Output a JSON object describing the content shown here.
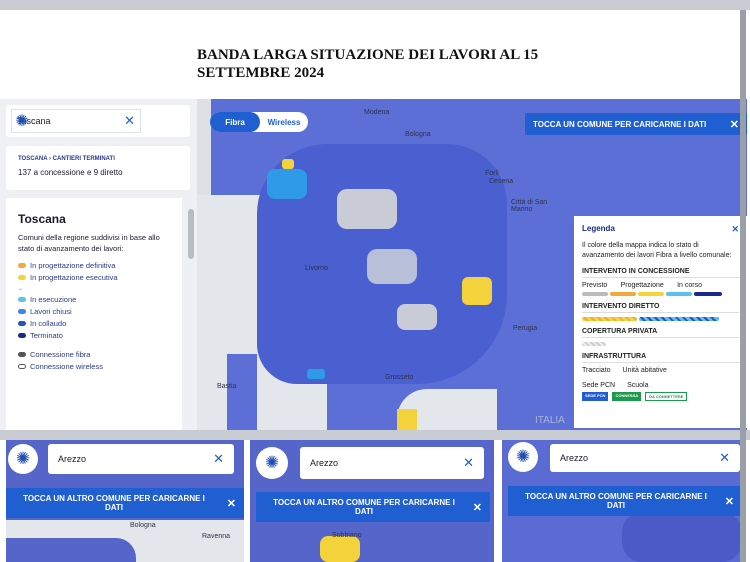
{
  "heading": {
    "line1": "BANDA LARGA SITUAZIONE DEI LAVORI AL 15",
    "line2": "SETTEMBRE 2024"
  },
  "search_main": {
    "value": "Toscana"
  },
  "breadcrumb": {
    "path": "TOSCANA › CANTIERI TERMINATI",
    "summary": "137 a concessione e 9 diretto"
  },
  "info": {
    "title": "Toscana",
    "description": "Comuni della regione suddivisi in base allo stato di avanzamento dei lavori:",
    "items": [
      {
        "label": "In progettazione definitiva",
        "color": "#f2a93b"
      },
      {
        "label": "In progettazione esecutiva",
        "color": "#f5d33b"
      },
      {
        "label": "In esecuzione",
        "color": "#5bc2f0"
      },
      {
        "label": "Lavori chiusi",
        "color": "#3b86e6"
      },
      {
        "label": "In collaudo",
        "color": "#2d4fc2"
      },
      {
        "label": "Terminato",
        "color": "#1a2a8c"
      }
    ],
    "conn": [
      {
        "label": "Connessione fibra"
      },
      {
        "label": "Connessione wireless"
      }
    ]
  },
  "toggle": {
    "fibra": "Fibra",
    "wireless": "Wireless"
  },
  "toast_main": "TOCCA UN COMUNE PER CARICARNE I DATI",
  "cities": [
    {
      "name": "Modena"
    },
    {
      "name": "Bologna"
    },
    {
      "name": "Forlì"
    },
    {
      "name": "Cesena"
    },
    {
      "name": "Città di San Marino"
    },
    {
      "name": "Livorno"
    },
    {
      "name": "Perugia"
    },
    {
      "name": "Grosseto"
    },
    {
      "name": "Bastia"
    },
    {
      "name": "ITALIA"
    }
  ],
  "legend": {
    "title": "Legenda",
    "intro": "Il colore della mappa indica lo stato di avanzamento dei lavori Fibra a livello comunale:",
    "concessione": "INTERVENTO IN CONCESSIONE",
    "previsto": "Previsto",
    "progettazione": "Progettazione",
    "in_corso": "In corso",
    "diretto": "INTERVENTO DIRETTO",
    "privata": "COPERTURA PRIVATA",
    "infra": "INFRASTRUTTURA",
    "tracciato": "Tracciato",
    "unita": "Unità abitative",
    "sede": "Sede PCN",
    "scuola": "Scuola",
    "badge1": "SEDE PCN",
    "badge2": "CONNESSA",
    "badge3": "DA CONNETTERE"
  },
  "panels": [
    {
      "search": "Arezzo",
      "toast": "TOCCA UN ALTRO COMUNE PER CARICARNE I DATI",
      "cities": [
        "Bologna",
        "Ravenna"
      ]
    },
    {
      "search": "Arezzo",
      "toast": "TOCCA UN ALTRO COMUNE PER CARICARNE I DATI",
      "cities": [
        "Subbiano"
      ]
    },
    {
      "search": "Arezzo",
      "toast": "TOCCA UN ALTRO COMUNE PER CARICARNE I DATI",
      "cities": []
    }
  ]
}
